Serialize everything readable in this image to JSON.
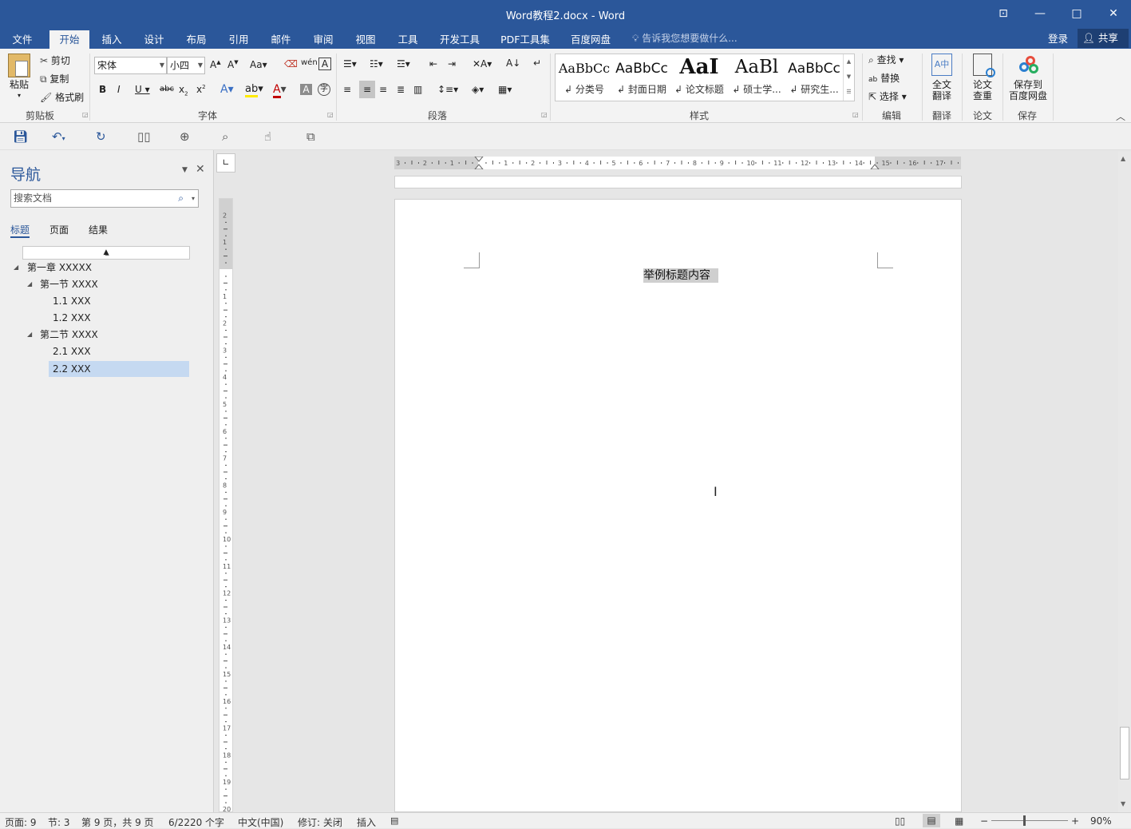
{
  "window": {
    "title": "Word教程2.docx - Word"
  },
  "tabs": [
    "文件",
    "开始",
    "插入",
    "设计",
    "布局",
    "引用",
    "邮件",
    "审阅",
    "视图",
    "工具",
    "开发工具",
    "PDF工具集",
    "百度网盘"
  ],
  "active_tab": "开始",
  "tell_me": "告诉我您想要做什么...",
  "account": {
    "login": "登录",
    "share": "共享"
  },
  "clipboard": {
    "paste": "粘贴",
    "cut": "剪切",
    "copy": "复制",
    "format_painter": "格式刷",
    "label": "剪贴板"
  },
  "font": {
    "name": "宋体",
    "size": "小四",
    "label": "字体"
  },
  "paragraph": {
    "label": "段落"
  },
  "styles": {
    "label": "样式",
    "items": [
      {
        "preview": "AaBbCc",
        "name": "分类号"
      },
      {
        "preview": "AaBbCc",
        "name": "封面日期"
      },
      {
        "preview": "AaI",
        "name": "论文标题"
      },
      {
        "preview": "AaBl",
        "name": "硕士学..."
      },
      {
        "preview": "AaBbCc",
        "name": "研究生..."
      }
    ]
  },
  "editing": {
    "find": "查找",
    "replace": "替换",
    "select": "选择",
    "label": "编辑"
  },
  "translate": {
    "btn_line1": "全文",
    "btn_line2": "翻译",
    "label": "翻译"
  },
  "paper": {
    "btn_line1": "论文",
    "btn_line2": "查重",
    "label": "论文"
  },
  "save": {
    "btn_line1": "保存到",
    "btn_line2": "百度网盘",
    "label": "保存"
  },
  "nav": {
    "title": "导航",
    "search_placeholder": "搜索文档",
    "tabs": [
      "标题",
      "页面",
      "结果"
    ],
    "tree": [
      {
        "text": "第一章 XXXXX",
        "level": 0,
        "expanded": true
      },
      {
        "text": "第一节 XXXX",
        "level": 1,
        "expanded": true
      },
      {
        "text": "1.1 XXX",
        "level": 2
      },
      {
        "text": "1.2 XXX",
        "level": 2
      },
      {
        "text": "第二节 XXXX",
        "level": 1,
        "expanded": true
      },
      {
        "text": "2.1 XXX",
        "level": 2
      },
      {
        "text": "2.2 XXX",
        "level": 2,
        "selected": true
      }
    ]
  },
  "document": {
    "heading": "举例标题内容"
  },
  "status": {
    "page": "页面: 9",
    "section": "节: 3",
    "pages": "第 9 页，共 9 页",
    "words": "6/2220 个字",
    "language": "中文(中国)",
    "track": "修订: 关闭",
    "mode": "插入",
    "zoom": "90%"
  },
  "colors": {
    "brand": "#2b579a",
    "selection": "#c5d9f1"
  }
}
